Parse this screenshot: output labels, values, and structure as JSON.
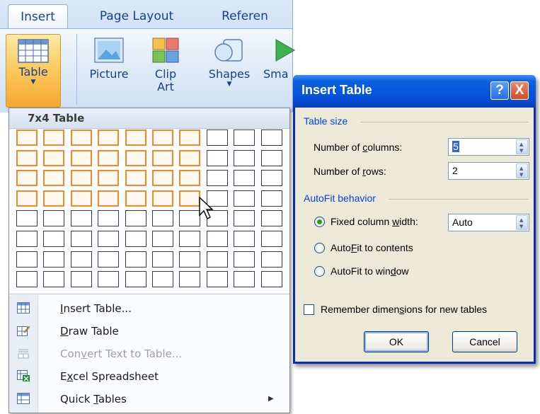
{
  "ribbon": {
    "tabs": [
      {
        "label": "Insert",
        "active": true
      },
      {
        "label": "Page Layout",
        "active": false
      },
      {
        "label": "Referen",
        "active": false
      }
    ],
    "buttons": {
      "table": "Table",
      "picture": "Picture",
      "clip_art_line1": "Clip",
      "clip_art_line2": "Art",
      "shapes": "Shapes",
      "smartart": "Sma"
    }
  },
  "dropdown": {
    "header": "7x4 Table",
    "grid": {
      "columns": 10,
      "rows": 8,
      "highlight_columns": 7,
      "highlight_rows": 4
    },
    "menu": [
      {
        "label": "Insert Table...",
        "accel": "I",
        "icon": "insert-table-icon",
        "enabled": true
      },
      {
        "label": "Draw Table",
        "accel": "D",
        "icon": "draw-table-icon",
        "enabled": true
      },
      {
        "label": "Convert Text to Table...",
        "accel": "v",
        "icon": "convert-text-icon",
        "enabled": false
      },
      {
        "label": "Excel Spreadsheet",
        "accel": "x",
        "icon": "excel-spreadsheet-icon",
        "enabled": true
      },
      {
        "label": "Quick Tables",
        "accel": "T",
        "icon": "quick-tables-icon",
        "enabled": true,
        "submenu": true
      }
    ]
  },
  "dialog": {
    "title": "Insert Table",
    "help_button": "?",
    "close_button": "X",
    "table_size": {
      "group_label": "Table size",
      "columns_label_pre": "Number of ",
      "columns_label_accel": "c",
      "columns_label_post": "olumns:",
      "columns_value": "5",
      "rows_label_pre": "Number of ",
      "rows_label_accel": "r",
      "rows_label_post": "ows:",
      "rows_value": "2"
    },
    "autofit": {
      "group_label": "AutoFit behavior",
      "fixed_pre": "Fixed column ",
      "fixed_accel": "w",
      "fixed_post": "idth:",
      "fixed_value": "Auto",
      "contents_pre": "Auto",
      "contents_accel": "F",
      "contents_post": "it to contents",
      "window_pre": "AutoFit to win",
      "window_accel": "d",
      "window_post": "ow",
      "selected": "fixed"
    },
    "remember": {
      "pre": "Remember dimen",
      "accel": "s",
      "post": "ions for new tables",
      "checked": false
    },
    "ok": "OK",
    "cancel": "Cancel"
  },
  "colors": {
    "accent_orange": "#f08a24",
    "titlebar_blue": "#0651d8",
    "ribbon_text": "#15428b"
  }
}
